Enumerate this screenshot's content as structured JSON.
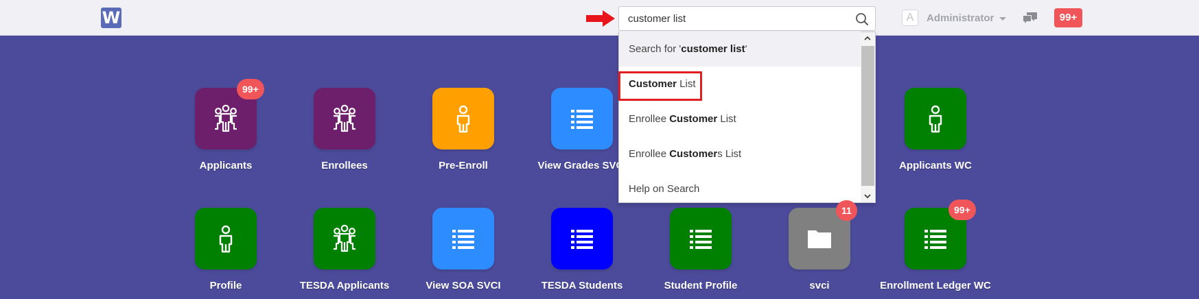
{
  "navbar": {
    "logo_letter": "W",
    "search_value": "customer list",
    "user_avatar_letter": "A",
    "user_name": "Administrator",
    "notification_badge": "99+"
  },
  "dropdown": {
    "items": [
      {
        "parts": [
          {
            "t": "Search for '",
            "b": false
          },
          {
            "t": "customer list",
            "b": true
          },
          {
            "t": "'",
            "b": false
          }
        ]
      },
      {
        "parts": [
          {
            "t": "Customer",
            "b": true
          },
          {
            "t": " List",
            "b": false
          }
        ]
      },
      {
        "parts": [
          {
            "t": "Enrollee ",
            "b": false
          },
          {
            "t": "Customer",
            "b": true
          },
          {
            "t": " List",
            "b": false
          }
        ]
      },
      {
        "parts": [
          {
            "t": "Enrollee ",
            "b": false
          },
          {
            "t": "Customer",
            "b": true
          },
          {
            "t": "s List",
            "b": false
          }
        ]
      },
      {
        "parts": [
          {
            "t": "Help on Search",
            "b": false
          }
        ]
      }
    ]
  },
  "apps": [
    {
      "label": "Applicants",
      "icon": "users-icon",
      "color": "#6d1f6b",
      "badge": "99+"
    },
    {
      "label": "Enrollees",
      "icon": "users-icon",
      "color": "#6d1f6b",
      "badge": ""
    },
    {
      "label": "Pre-Enroll",
      "icon": "user-icon",
      "color": "#ffa000",
      "badge": ""
    },
    {
      "label": "View Grades SVCI",
      "icon": "list-icon",
      "color": "#2d8cff",
      "badge": ""
    },
    {
      "label": "Applicants WC",
      "icon": "user-icon",
      "color": "#008000",
      "badge": ""
    },
    {
      "label": "Profile",
      "icon": "user-icon",
      "color": "#008000",
      "badge": ""
    },
    {
      "label": "TESDA Applicants",
      "icon": "users-icon",
      "color": "#008000",
      "badge": ""
    },
    {
      "label": "View SOA SVCI",
      "icon": "list-icon",
      "color": "#2d8cff",
      "badge": ""
    },
    {
      "label": "TESDA Students",
      "icon": "list-icon",
      "color": "#0000ff",
      "badge": ""
    },
    {
      "label": "Student Profile",
      "icon": "list-icon",
      "color": "#008000",
      "badge": ""
    },
    {
      "label": "svci",
      "icon": "folder-icon",
      "color": "#808080",
      "badge": "11"
    },
    {
      "label": "Enrollment Ledger WC",
      "icon": "list-icon",
      "color": "#008000",
      "badge": "99+"
    }
  ]
}
